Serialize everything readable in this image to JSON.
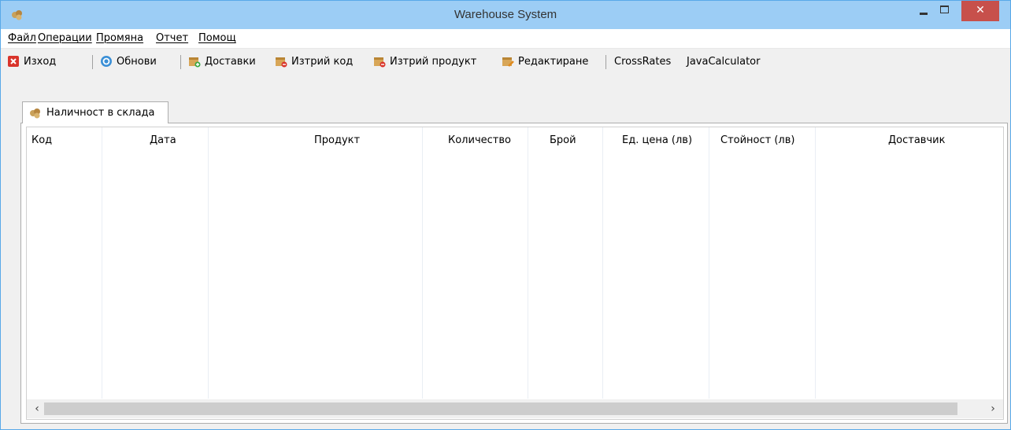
{
  "window": {
    "title": "Warehouse System",
    "close_glyph": "✕",
    "title_bar_color": "#9ccdf5",
    "close_button_color": "#c7504b"
  },
  "menu": {
    "items": [
      "Файл",
      "Операции",
      "Промяна",
      "Отчет",
      "Помощ"
    ]
  },
  "toolbar": {
    "exit_label": "Изход",
    "exit_icon": "red-x-icon",
    "refresh_label": "Обнови",
    "refresh_icon": "refresh-icon",
    "deliveries_label": "Доставки",
    "deliveries_icon": "box-add-icon",
    "delete_code_label": "Изтрий код",
    "delete_code_icon": "box-delete-icon",
    "delete_product_label": "Изтрий продукт",
    "delete_product_icon": "box-delete-icon",
    "edit_label": "Редактиране",
    "edit_icon": "box-edit-icon",
    "crossrates_label": "CrossRates",
    "javacalc_label": "JavaCalculator"
  },
  "tabs": [
    {
      "label": "Наличност в склада",
      "icon": "products-icon",
      "selected": true
    }
  ],
  "table": {
    "columns": [
      "Код",
      "Дата",
      "Продукт",
      "Количество",
      "Брой",
      "Ед. цена (лв)",
      "Стойност (лв)",
      "Доставчик"
    ],
    "rows": []
  },
  "scrollbar": {
    "left_glyph": "‹",
    "right_glyph": "›"
  }
}
